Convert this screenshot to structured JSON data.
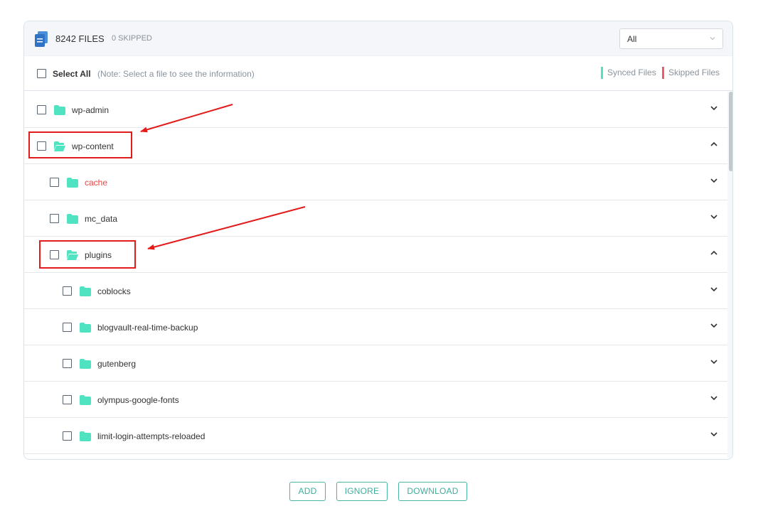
{
  "header": {
    "files_count": "8242 FILES",
    "skipped_count": "0 SKIPPED",
    "filter": {
      "selected": "All"
    }
  },
  "toolbar": {
    "select_all": "Select All",
    "note": "(Note: Select a file to see the information)",
    "legend": {
      "synced": "Synced Files",
      "skipped": "Skipped Files",
      "synced_color": "#4fe3c1",
      "skipped_color": "#ef5a6f"
    }
  },
  "tree": [
    {
      "name": "wp-admin",
      "depth": 0,
      "expanded": false,
      "status": "synced"
    },
    {
      "name": "wp-content",
      "depth": 0,
      "expanded": true,
      "status": "synced"
    },
    {
      "name": "cache",
      "depth": 1,
      "expanded": false,
      "status": "skipped"
    },
    {
      "name": "mc_data",
      "depth": 1,
      "expanded": false,
      "status": "synced"
    },
    {
      "name": "plugins",
      "depth": 1,
      "expanded": true,
      "status": "synced"
    },
    {
      "name": "coblocks",
      "depth": 2,
      "expanded": false,
      "status": "synced"
    },
    {
      "name": "blogvault-real-time-backup",
      "depth": 2,
      "expanded": false,
      "status": "synced"
    },
    {
      "name": "gutenberg",
      "depth": 2,
      "expanded": false,
      "status": "synced"
    },
    {
      "name": "olympus-google-fonts",
      "depth": 2,
      "expanded": false,
      "status": "synced"
    },
    {
      "name": "limit-login-attempts-reloaded",
      "depth": 2,
      "expanded": false,
      "status": "synced"
    }
  ],
  "actions": {
    "add": "ADD",
    "ignore": "IGNORE",
    "download": "DOWNLOAD"
  },
  "colors": {
    "accent": "#3fae9b",
    "folder": "#4fe3c1",
    "annotation": "#e41b1b"
  }
}
